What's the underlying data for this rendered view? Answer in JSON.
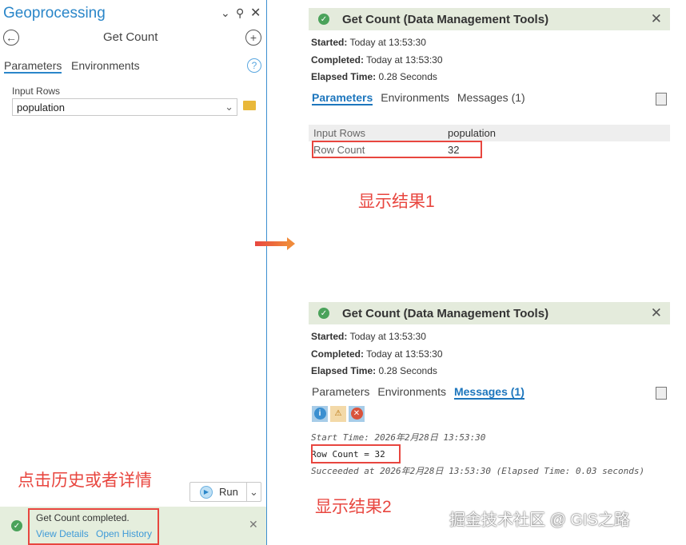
{
  "left": {
    "title": "Geoprocessing",
    "tool_name": "Get Count",
    "tabs": [
      "Parameters",
      "Environments"
    ],
    "input_label": "Input Rows",
    "input_value": "population",
    "run_label": "Run",
    "status_text": "Get Count completed.",
    "view_details": "View Details",
    "open_history": "Open History"
  },
  "annotations": {
    "click": "点击历史或者详情",
    "result1": "显示结果1",
    "result2": "显示结果2",
    "watermark": "掘金技术社区 @ GIS之路"
  },
  "panel": {
    "title": "Get Count (Data Management Tools)",
    "started_label": "Started:",
    "started": "Today at 13:53:30",
    "completed_label": "Completed:",
    "completed": "Today at 13:53:30",
    "elapsed_label": "Elapsed Time:",
    "elapsed": "0.28 Seconds",
    "tabs": [
      "Parameters",
      "Environments",
      "Messages (1)"
    ]
  },
  "params": [
    {
      "name": "Input Rows",
      "value": "population"
    },
    {
      "name": "Row Count",
      "value": "32"
    }
  ],
  "messages": [
    "Start Time: 2026年2月28日 13:53:30",
    "Row Count = 32",
    "Succeeded at 2026年2月28日 13:53:30 (Elapsed Time: 0.03 seconds)"
  ]
}
